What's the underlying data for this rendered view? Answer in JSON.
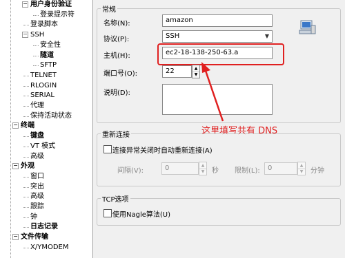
{
  "tree": [
    {
      "label": "用户身份验证",
      "bold": true
    },
    {
      "label": "登录提示符"
    },
    {
      "label": "登录脚本"
    },
    {
      "label": "SSH"
    },
    {
      "label": "安全性"
    },
    {
      "label": "隧道",
      "bold": true
    },
    {
      "label": "SFTP"
    },
    {
      "label": "TELNET"
    },
    {
      "label": "RLOGIN"
    },
    {
      "label": "SERIAL"
    },
    {
      "label": "代理"
    },
    {
      "label": "保持活动状态"
    },
    {
      "label": "终端",
      "bold": true
    },
    {
      "label": "键盘",
      "bold": true
    },
    {
      "label": "VT 模式"
    },
    {
      "label": "高级"
    },
    {
      "label": "外观",
      "bold": true
    },
    {
      "label": "窗口"
    },
    {
      "label": "突出"
    },
    {
      "label": "高级"
    },
    {
      "label": "跟踪"
    },
    {
      "label": "钟"
    },
    {
      "label": "日志记录",
      "bold": true
    },
    {
      "label": "文件传输",
      "bold": true
    },
    {
      "label": "X/YMODEM"
    }
  ],
  "general": {
    "title": "常规",
    "name_label": "名称(N):",
    "name_value": "amazon",
    "protocol_label": "协议(P):",
    "protocol_value": "SSH",
    "host_label": "主机(H):",
    "host_value": "ec2-18-138-250-63.a",
    "port_label": "端口号(O):",
    "port_value": "22",
    "desc_label": "说明(D):"
  },
  "reconnect": {
    "title": "重新连接",
    "checkbox_label": "连接异常关闭时自动重新连接(A)",
    "interval_label": "间隔(V):",
    "interval_value": "0",
    "interval_unit": "秒",
    "limit_label": "限制(L):",
    "limit_value": "0",
    "limit_unit": "分钟"
  },
  "tcp": {
    "title": "TCP选项",
    "nagle_label": "使用Nagle算法(U)"
  },
  "annotation": {
    "text": "这里填写共有 DNS",
    "color": "#e02020"
  }
}
